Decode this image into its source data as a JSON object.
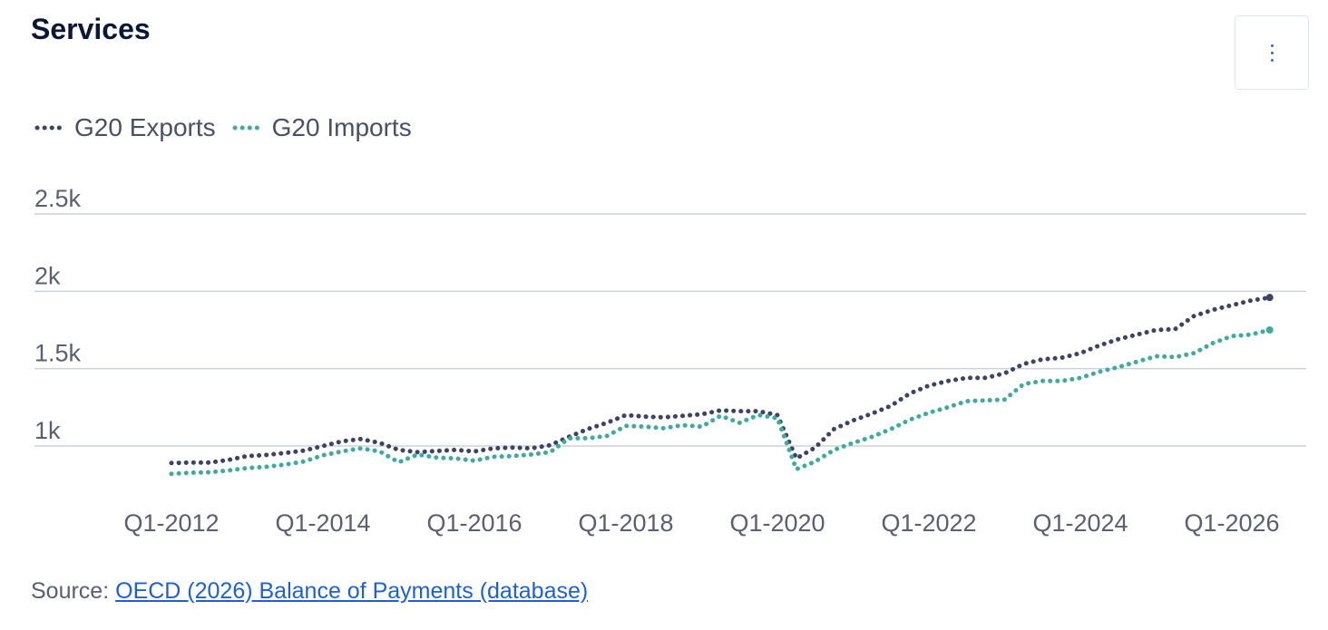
{
  "header": {
    "title": "Services",
    "menu_icon": "more-vertical-icon"
  },
  "legend": [
    {
      "label": "G20 Exports",
      "color": "#3d4363"
    },
    {
      "label": "G20 Imports",
      "color": "#40aaa0"
    }
  ],
  "chart_data": {
    "type": "line",
    "title": "Services",
    "y_ticks": [
      "2.5k",
      "2k",
      "1.5k",
      "1k"
    ],
    "y_tick_values": [
      2500,
      2000,
      1500,
      1000
    ],
    "ylim": [
      700,
      2550
    ],
    "x_ticks": [
      "Q1-2012",
      "Q1-2014",
      "Q1-2016",
      "Q1-2018",
      "Q1-2020",
      "Q1-2022",
      "Q1-2024",
      "Q1-2026"
    ],
    "x_start": "Q1-2012",
    "grid": true,
    "legend_position": "top-left",
    "series": [
      {
        "name": "G20 Exports",
        "color": "#3d4363",
        "values": [
          890,
          893,
          893,
          910,
          935,
          942,
          955,
          970,
          1000,
          1030,
          1045,
          1020,
          975,
          960,
          968,
          975,
          965,
          985,
          990,
          985,
          1005,
          1060,
          1110,
          1150,
          1200,
          1190,
          1185,
          1195,
          1205,
          1230,
          1225,
          1225,
          1200,
          920,
          990,
          1110,
          1165,
          1210,
          1260,
          1340,
          1390,
          1420,
          1440,
          1440,
          1470,
          1530,
          1560,
          1570,
          1600,
          1650,
          1690,
          1720,
          1750,
          1755,
          1840,
          1880,
          1910,
          1940,
          1960
        ]
      },
      {
        "name": "G20 Imports",
        "color": "#40aaa0",
        "values": [
          820,
          827,
          830,
          842,
          857,
          865,
          880,
          900,
          940,
          965,
          985,
          965,
          895,
          945,
          925,
          920,
          905,
          930,
          935,
          945,
          960,
          1050,
          1050,
          1065,
          1130,
          1125,
          1115,
          1135,
          1125,
          1195,
          1150,
          1200,
          1180,
          850,
          900,
          975,
          1020,
          1060,
          1110,
          1170,
          1215,
          1250,
          1290,
          1295,
          1300,
          1400,
          1420,
          1420,
          1440,
          1480,
          1510,
          1545,
          1580,
          1575,
          1600,
          1665,
          1710,
          1720,
          1750
        ]
      }
    ]
  },
  "footer": {
    "source_label": "Source:",
    "source_link": "OECD (2026) Balance of Payments (database)"
  }
}
